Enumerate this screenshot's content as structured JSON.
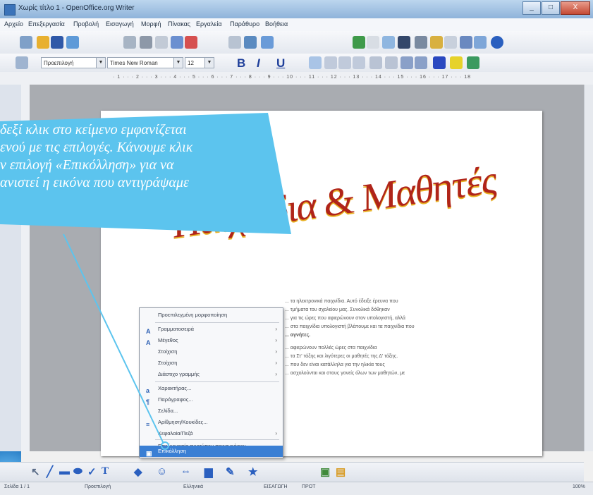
{
  "window": {
    "title": "Χωρίς τίτλο 1 - OpenOffice.org Writer",
    "controls": [
      "_",
      "□",
      "X"
    ]
  },
  "menubar": {
    "items": [
      "Αρχείο",
      "Επεξεργασία",
      "Προβολή",
      "Εισαγωγή",
      "Μορφή",
      "Πίνακας",
      "Εργαλεία",
      "Παράθυρο",
      "Βοήθεια"
    ]
  },
  "formatbar": {
    "style": "Προεπιλογή",
    "font": "Times New Roman",
    "size": "12",
    "bold": "B",
    "italic": "I",
    "underline": "U"
  },
  "ruler": {
    "ticks": "· 1 · · · 2 · · · 3 · · · 4 · · · 5 · · · 6 · · · 7 · · · 8 · · · 9 · · · 10 · · · 11 · · · 12 · · · 13 · · · 14 · · · 15 · · · 16 · · · 17 · · · 18"
  },
  "document": {
    "wordart": "Παιχνίδια & Μαθητές",
    "body_lines": [
      "... τα ηλεκτρονικά παιχνίδια. Αυτό έδειξε έρευνα που",
      "... τμήματα του σχολείου μας. Συνολικά δόθηκαν",
      "... για τις ώρες που αφιερώνουν στον υπολογιστή, αλλά",
      "... στα παιχνίδια υπολογιστή βλέπουμε και τα παιχνίδια που",
      "... αγνήτες.",
      "... αφιερώνουν πολλές ώρες στα παιχνίδια",
      "... τα Στ' τάξης και λιγότερες οι μαθητές της Δ' τάξης.",
      "... που δεν είναι κατάλληλα για την ηλικία τους",
      "... ασχολούνται και στους γονείς όλων των μαθητών, με"
    ]
  },
  "context_menu": {
    "items": [
      {
        "label": "Προεπιλεγμένη μορφοποίηση",
        "icon": "",
        "submenu": false,
        "selected": false
      },
      {
        "label": "Γραμματοσειρά",
        "icon": "font-icon",
        "submenu": true,
        "selected": false
      },
      {
        "label": "Μέγεθος",
        "icon": "font-size-icon",
        "submenu": true,
        "selected": false
      },
      {
        "label": "Στοίχιση",
        "icon": "",
        "submenu": true,
        "selected": false
      },
      {
        "label": "Στοίχιση",
        "icon": "",
        "submenu": true,
        "selected": false
      },
      {
        "label": "Διάστιχο γραμμής",
        "icon": "",
        "submenu": true,
        "selected": false
      },
      {
        "label": "Χαρακτήρας...",
        "icon": "character-icon",
        "submenu": false,
        "selected": false
      },
      {
        "label": "Παράγραφος...",
        "icon": "paragraph-icon",
        "submenu": false,
        "selected": false
      },
      {
        "label": "Σελίδα...",
        "icon": "",
        "submenu": false,
        "selected": false
      },
      {
        "label": "Αρίθμηση/Κουκίδες...",
        "icon": "numbering-icon",
        "submenu": false,
        "selected": false
      },
      {
        "label": "Κεφαλαία/Πεζά",
        "icon": "",
        "submenu": true,
        "selected": false
      },
      {
        "label": "Επεξεργασία προτύπου παραγράφου...",
        "icon": "",
        "submenu": false,
        "selected": false
      },
      {
        "label": "Επικόλληση",
        "icon": "paste-icon",
        "submenu": false,
        "selected": true
      }
    ]
  },
  "callout": {
    "lines": [
      "δεξί κλικ στο κείμενο εμφανίζεται",
      "ενού με τις επιλογές. Κάνουμε κλικ",
      "ν επιλογή «Επικόλληση» για να",
      "ανιστεί η εικόνα που αντιγράψαμε"
    ],
    "color": "#5cc4ee",
    "line_color": "#5cc4ee"
  },
  "statusbar": {
    "page": "Σελίδα 1 / 1",
    "style": "Προεπιλογή",
    "language": "Ελληνικά",
    "mode": "ΕΙΣΑΓΩΓΗ",
    "selection": "ΠΡΟΤ",
    "zoom": "100%"
  }
}
